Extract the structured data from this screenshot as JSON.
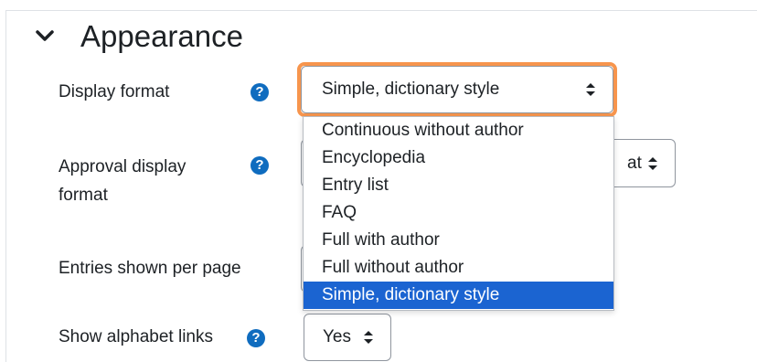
{
  "section": {
    "title": "Appearance",
    "icon": "chevron-down-icon"
  },
  "fields": {
    "display_format": {
      "label": "Display format",
      "value": "Simple, dictionary style",
      "options": [
        "Continuous without author",
        "Encyclopedia",
        "Entry list",
        "FAQ",
        "Full with author",
        "Full without author",
        "Simple, dictionary style"
      ],
      "selected": "Simple, dictionary style"
    },
    "approval_display_format": {
      "label_line1": "Approval display",
      "label_line2": "format",
      "value_partial": "at"
    },
    "entries_per_page": {
      "label": "Entries shown per page"
    },
    "show_alphabet_links": {
      "label": "Show alphabet links",
      "value": "Yes"
    }
  },
  "icons": {
    "help": "question-circle-icon",
    "updown": "up-down-caret-icon"
  },
  "colors": {
    "focus": "#f7954d",
    "help_bg": "#0f6cbf",
    "selected_bg": "#1b64d1"
  }
}
